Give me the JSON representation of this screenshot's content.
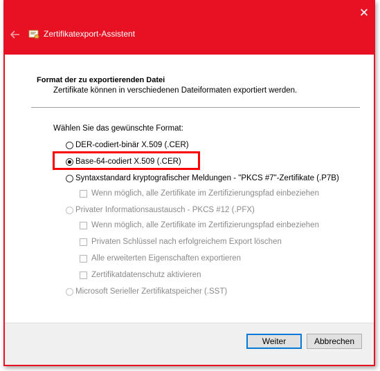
{
  "window": {
    "title": "Zertifikatexport-Assistent",
    "close_glyph": "✕",
    "accent_color": "#e81123"
  },
  "page": {
    "heading": "Format der zu exportierenden Datei",
    "subheading": "Zertifikate können in verschiedenen Dateiformaten exportiert werden.",
    "prompt": "Wählen Sie das gewünschte Format:"
  },
  "options": {
    "der": "DER-codiert-binär X.509 (.CER)",
    "base64": "Base-64-codiert X.509 (.CER)",
    "pkcs7": "Syntaxstandard kryptografischer Meldungen - \"PKCS #7\"-Zertifikate (.P7B)",
    "pkcs7_include_all": "Wenn möglich, alle Zertifikate im Zertifizierungspfad einbeziehen",
    "pfx": "Privater Informationsaustausch - PKCS #12 (.PFX)",
    "pfx_include_all": "Wenn möglich, alle Zertifikate im Zertifizierungspfad einbeziehen",
    "pfx_delete_key": "Privaten Schlüssel nach erfolgreichem Export löschen",
    "pfx_export_props": "Alle erweiterten Eigenschaften exportieren",
    "pfx_privacy": "Zertifikatdatenschutz aktivieren",
    "sst": "Microsoft Serieller Zertifikatspeicher (.SST)",
    "selected": "base64"
  },
  "buttons": {
    "next": "Weiter",
    "cancel": "Abbrechen"
  }
}
